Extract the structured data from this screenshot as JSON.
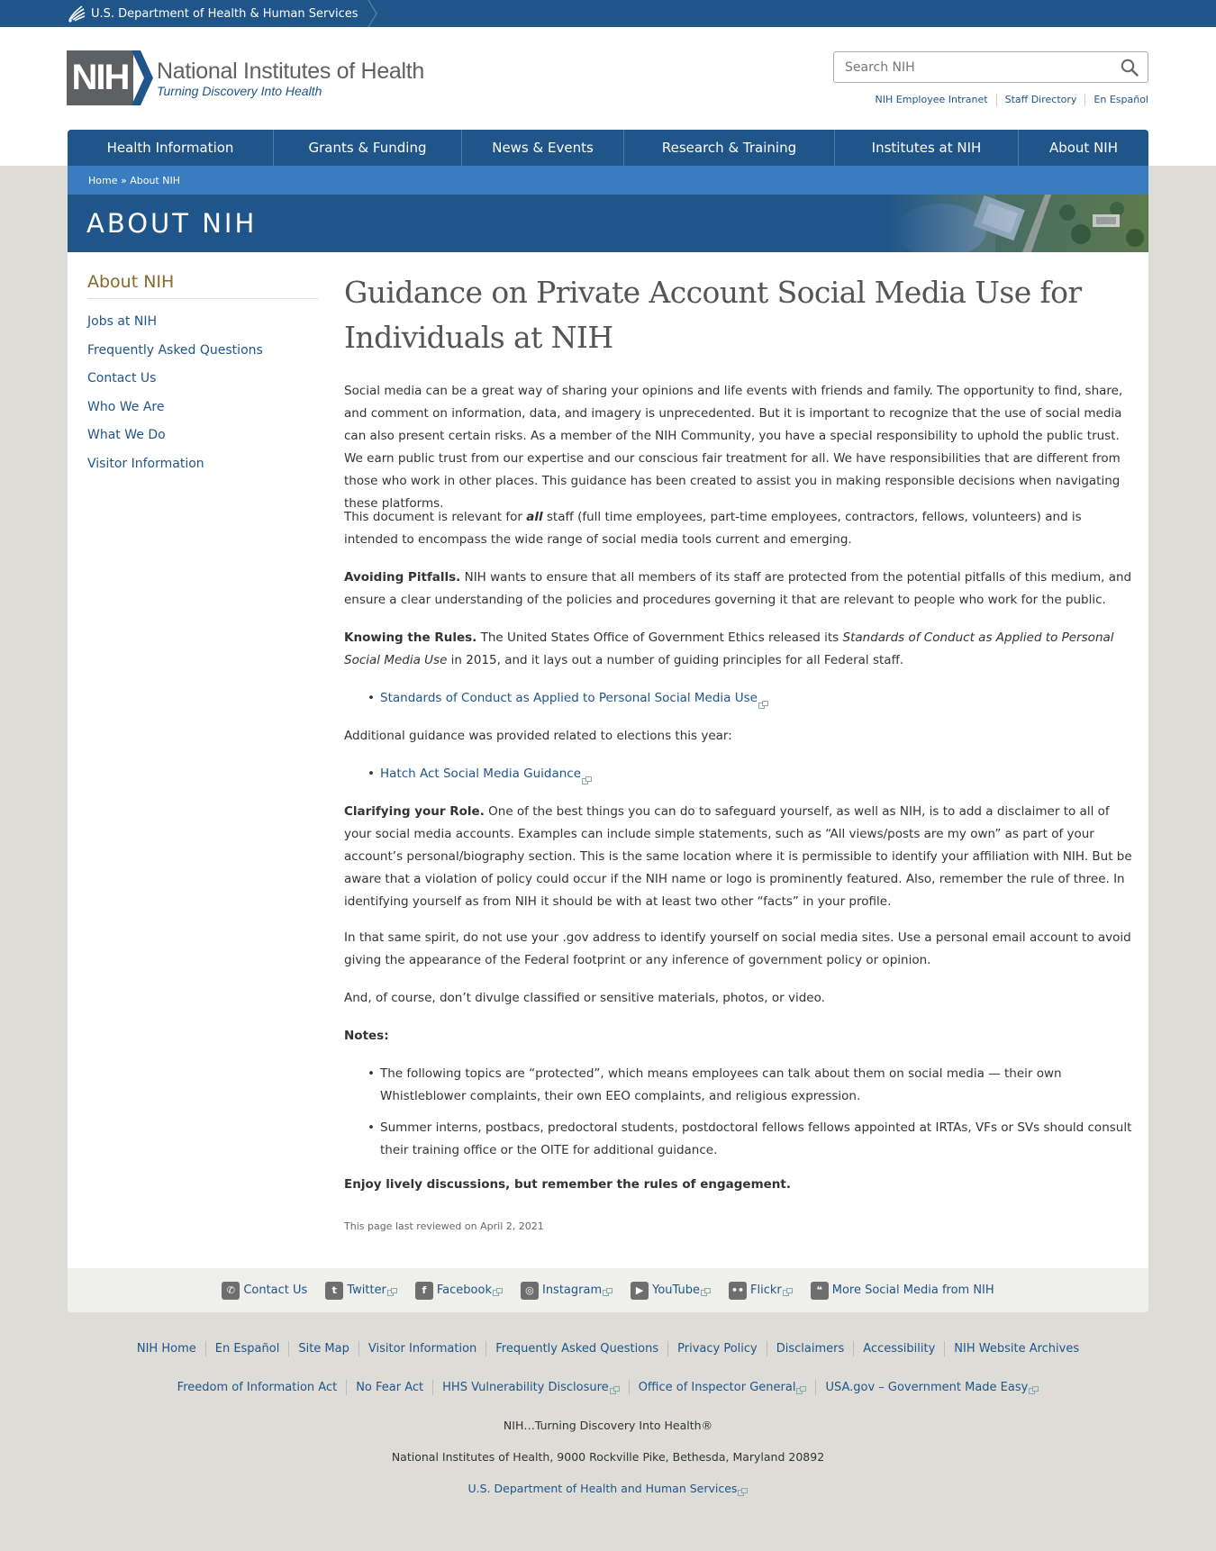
{
  "hhs": {
    "label": "U.S. Department of Health & Human Services"
  },
  "header": {
    "logo_abbr": "NIH",
    "logo_title": "National Institutes of Health",
    "logo_tagline": "Turning Discovery Into Health",
    "search_placeholder": "Search NIH",
    "utility_links": [
      "NIH Employee Intranet",
      "Staff Directory",
      "En Español"
    ]
  },
  "nav": {
    "items": [
      "Health Information",
      "Grants & Funding",
      "News & Events",
      "Research & Training",
      "Institutes at NIH",
      "About NIH"
    ]
  },
  "breadcrumb": {
    "home": "Home",
    "separator": " » ",
    "current": "About NIH"
  },
  "banner": {
    "title": "ABOUT NIH"
  },
  "sidebar": {
    "title": "About NIH",
    "items": [
      "Jobs at NIH",
      "Frequently Asked Questions",
      "Contact Us",
      "Who We Are",
      "What We Do",
      "Visitor Information"
    ]
  },
  "article": {
    "title": "Guidance on Private Account Social Media Use for Individuals at NIH",
    "p1": "Social media can be a great way of sharing your opinions and life events with friends and family. The opportunity to find, share, and comment on information, data, and imagery is unprecedented. But it is important to recognize that the use of social media can also present certain risks. As a member of the NIH Community, you have a special responsibility to uphold the public trust. We earn public trust from our expertise and our conscious fair treatment for all. We have responsibilities that are different from those who work in other places. This guidance has been created to assist you in making responsible decisions when navigating these platforms.",
    "p2_a": "This document is relevant for ",
    "p2_em": "all",
    "p2_b": " staff (full time employees, part-time employees, contractors, fellows, volunteers) and is intended to encompass the wide range of social media tools current and emerging.",
    "p3_strong": "Avoiding Pitfalls.",
    "p3_text": " NIH wants to ensure that all members of its staff are protected from the potential pitfalls of this medium, and ensure a clear understanding of the policies and procedures governing it that are relevant to people who work for the public.",
    "p4_strong": "Knowing the Rules.",
    "p4_text_a": " The United States Office of Government Ethics released its ",
    "p4_em": "Standards of Conduct as Applied to Personal Social Media Use",
    "p4_text_b": " in 2015, and it lays out a number of guiding principles for all Federal staff.",
    "link1": "Standards of Conduct as Applied to Personal Social Media Use",
    "p5": "Additional guidance was provided related to elections this year:",
    "link2": "Hatch Act Social Media Guidance",
    "p6_strong": "Clarifying your Role.",
    "p6_text": " One of the best things you can do to safeguard yourself, as well as NIH, is to add a disclaimer to all of your social media accounts. Examples can include simple statements, such as “All views/posts are my own” as part of your account’s personal/biography section. This is the same location where it is permissible to identify your affiliation with NIH. But be aware that a violation of policy could occur if the NIH name or logo is prominently featured. Also, remember the rule of three. In identifying yourself as from NIH it should be with at least two other “facts” in your profile.",
    "p7": "In that same spirit, do not use your .gov address to identify yourself on social media sites. Use a personal email account to avoid giving the appearance of the Federal footprint or any inference of government policy or opinion.",
    "p8": "And, of course, don’t divulge classified or sensitive materials, photos, or video.",
    "notes_heading": "Notes:",
    "notes": [
      "The following topics are “protected”, which means employees can talk about them on social media — their own Whistleblower complaints, their own EEO complaints, and religious expression.",
      "Summer interns, postbacs, predoctoral students, postdoctoral fellows fellows appointed at IRTAs, VFs or SVs should consult their training office or the OITE for additional guidance."
    ],
    "closing": "Enjoy lively discussions, but remember the rules of engagement.",
    "reviewed": "This page last reviewed on April 2, 2021"
  },
  "social": {
    "items": [
      {
        "label": "Contact Us",
        "icon": "phone-icon",
        "glyph": "✆"
      },
      {
        "label": "Twitter",
        "icon": "twitter-icon",
        "glyph": "t"
      },
      {
        "label": "Facebook",
        "icon": "facebook-icon",
        "glyph": "f"
      },
      {
        "label": "Instagram",
        "icon": "instagram-icon",
        "glyph": "◎"
      },
      {
        "label": "YouTube",
        "icon": "youtube-icon",
        "glyph": "▶"
      },
      {
        "label": "Flickr",
        "icon": "flickr-icon",
        "glyph": "••"
      },
      {
        "label": "More Social Media from NIH",
        "icon": "chat-bubbles-icon",
        "glyph": "❝"
      }
    ]
  },
  "footer": {
    "links_row1": [
      "NIH Home",
      "En Español",
      "Site Map",
      "Visitor Information",
      "Frequently Asked Questions",
      "Privacy Policy",
      "Disclaimers",
      "Accessibility",
      "NIH Website Archives"
    ],
    "links_row2": [
      "Freedom of Information Act",
      "No Fear Act",
      "HHS Vulnerability Disclosure",
      "Office of Inspector General",
      "USA.gov – Government Made Easy"
    ],
    "tagline": "NIH…Turning Discovery Into Health®",
    "address": "National Institutes of Health, 9000 Rockville Pike, Bethesda, Maryland 20892",
    "hhs_link": "U.S. Department of Health and Human Services"
  },
  "colors": {
    "primary": "#20558a",
    "breadcrumb": "#3a7cc0",
    "sidebar_title": "#8a6a2c",
    "page_bg": "#dddcd6"
  }
}
